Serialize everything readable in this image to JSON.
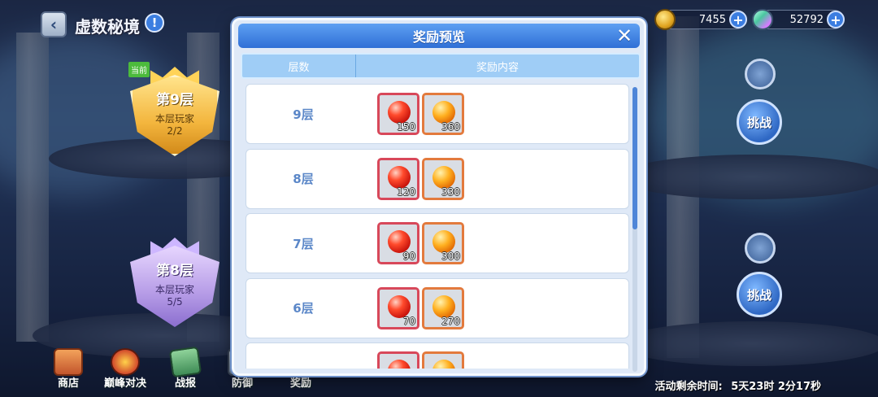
{
  "header": {
    "title": "虚数秘境",
    "back_icon": "back-arrow-icon",
    "info_icon": "info-icon"
  },
  "resources": [
    {
      "icon": "coin-icon",
      "value": "7455"
    },
    {
      "icon": "gem-icon",
      "value": "52792"
    }
  ],
  "floors": [
    {
      "tag": "当前",
      "name": "第9层",
      "sub": "本层玩家",
      "count": "2/2",
      "color": "#f3b53d"
    },
    {
      "name": "第8层",
      "sub": "本层玩家",
      "count": "5/5",
      "color": "#b59be6"
    }
  ],
  "challenge_label": "挑战",
  "bottom_nav": [
    {
      "label": "商店",
      "icon": "shop-icon"
    },
    {
      "label": "巅峰对决",
      "icon": "duel-icon"
    },
    {
      "label": "战报",
      "icon": "report-icon"
    },
    {
      "label": "防御",
      "icon": "defense-icon"
    },
    {
      "label": "奖励",
      "icon": "reward-icon"
    }
  ],
  "timer": {
    "label": "活动剩余时间:",
    "value": "5天23时 2分17秒"
  },
  "modal": {
    "title": "奖励预览",
    "close_icon": "close-icon",
    "columns": [
      "层数",
      "奖励内容"
    ],
    "rows": [
      {
        "level": "9层",
        "rewards": [
          {
            "type": "red-orb",
            "qty": "150"
          },
          {
            "type": "orange-orb",
            "qty": "360"
          }
        ]
      },
      {
        "level": "8层",
        "rewards": [
          {
            "type": "red-orb",
            "qty": "120"
          },
          {
            "type": "orange-orb",
            "qty": "330"
          }
        ]
      },
      {
        "level": "7层",
        "rewards": [
          {
            "type": "red-orb",
            "qty": "90"
          },
          {
            "type": "orange-orb",
            "qty": "300"
          }
        ]
      },
      {
        "level": "6层",
        "rewards": [
          {
            "type": "red-orb",
            "qty": "70"
          },
          {
            "type": "orange-orb",
            "qty": "270"
          }
        ]
      },
      {
        "level": "",
        "rewards": [
          {
            "type": "red-orb",
            "qty": ""
          },
          {
            "type": "orange-orb",
            "qty": ""
          }
        ]
      }
    ],
    "scroll_position": 0.0
  },
  "colors": {
    "accent": "#2f6fd6",
    "header_bg": "#9fcdf6",
    "red_frame": "#d8485a",
    "orange_frame": "#e37a3d"
  }
}
